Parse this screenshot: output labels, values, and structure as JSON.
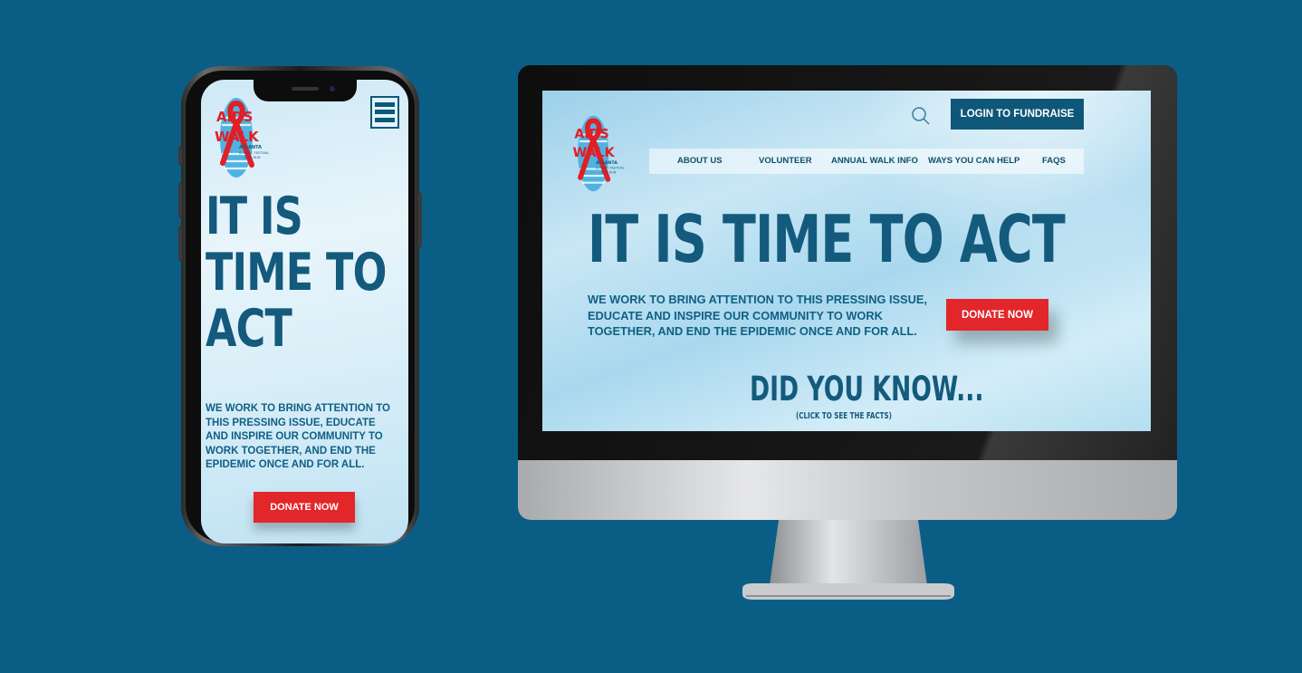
{
  "mobile": {
    "logo_text": [
      "AIDS",
      "WALK",
      "ATLANTA",
      "& MUSIC FESTIVAL",
      "& 5K RUN"
    ],
    "headline": [
      "IT IS",
      "TIME TO",
      "ACT"
    ],
    "body": "WE WORK TO BRING ATTENTION TO THIS PRESSING ISSUE, EDUCATE AND INSPIRE OUR COMMUNITY TO WORK TOGETHER, AND END THE EPIDEMIC ONCE AND FOR ALL.",
    "donate_label": "DONATE NOW",
    "menu_icon": "hamburger-menu-icon"
  },
  "desktop": {
    "logo_text": [
      "AIDS",
      "WALK",
      "ATLANTA",
      "& MUSIC FESTIVAL",
      "& 5K RUN"
    ],
    "login_label": "LOGIN TO FUNDRAISE",
    "search_icon": "search-icon",
    "nav": [
      "ABOUT US",
      "VOLUNTEER",
      "ANNUAL WALK INFO",
      "WAYS YOU CAN HELP",
      "FAQS"
    ],
    "headline": "IT IS TIME TO ACT",
    "body": "WE WORK TO BRING ATTENTION TO THIS PRESSING ISSUE, EDUCATE AND INSPIRE OUR COMMUNITY TO WORK TOGETHER, AND END THE EPIDEMIC ONCE AND FOR ALL.",
    "donate_label": "DONATE NOW",
    "did_you_know": "DID YOU KNOW...",
    "click_hint": "(CLICK TO SEE THE FACTS)"
  },
  "colors": {
    "background": "#0a5e85",
    "brand_blue": "#145a7c",
    "donate_red": "#e3262a",
    "ribbon_red": "#e01f26",
    "shoe_blue": "#4fb3e2"
  }
}
